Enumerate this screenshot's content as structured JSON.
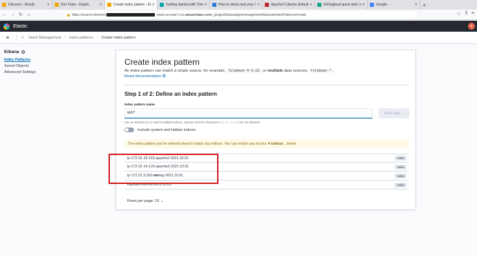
{
  "browser": {
    "tabs": [
      {
        "label": "Discover - Elastic",
        "color": "#f0a500",
        "active": false
      },
      {
        "label": "Dev Tools - Elastic",
        "color": "#f0a500",
        "active": false
      },
      {
        "label": "Create index pattern - Elastic",
        "color": "#f0a500",
        "active": true
      },
      {
        "label": "Getting started with Timelion",
        "color": "#00a4a6",
        "active": false
      },
      {
        "label": "How to stress test your CPU -",
        "color": "#2b7bd6",
        "active": false
      },
      {
        "label": "Apache2 Ubuntu Default Page: It",
        "color": "#c2272d",
        "active": false
      },
      {
        "label": "Winlogbeat quick start: install",
        "color": "#1aa48b",
        "active": false
      },
      {
        "label": "Google",
        "color": "#4285f4",
        "active": false
      }
    ],
    "url_prefix": "https://search-demoes",
    "url_host_mid": "-west-us-east-1.es.",
    "url_host": "amazonaws.com",
    "url_path": "/_plugin/kibana/app/management/kibana/indexPatterns/create"
  },
  "header": {
    "app_title": "Elastic",
    "avatar_initial": "a"
  },
  "breadcrumbs": [
    "Stack Management",
    "Index patterns",
    "Create index pattern"
  ],
  "sidenav": {
    "title": "Kibana",
    "items": [
      "Index Patterns",
      "Saved Objects",
      "Advanced Settings"
    ]
  },
  "panel": {
    "title": "Create index pattern",
    "desc_1": "An index pattern can match a single source, for example,",
    "code_1": "filebeat-4-3-22",
    "desc_2": ", or",
    "desc_bold": "multiple",
    "desc_3": "data sources,",
    "code_2": "filebeat-*",
    "desc_4": ".",
    "read_doc": "Read documentation",
    "step": "Step 1 of 2: Define an index pattern",
    "field_label": "Index pattern name",
    "field_value": "win*",
    "field_help": "Use an asterisk (*) to match multiple indices. Spaces and the characters \\, /, ?, \", <, >, | are not allowed.",
    "next_button": "Next step",
    "toggle_label": "Include system and hidden indices",
    "callout_1": "The index pattern you've entered doesn't match any indices. You can match any of your",
    "callout_bold": "4 indices",
    "callout_2": ", below.",
    "rows": [
      {
        "pre": "ip-172-31-10-110-apache2-2021.10.01",
        "hl": "",
        "post": "",
        "badge": "Index"
      },
      {
        "pre": "ip-172-31-14-120-apache2-2021.10.01",
        "hl": "",
        "post": "",
        "badge": "Index"
      },
      {
        "pre": "ip-172.31.3.182-",
        "hl": "win",
        "post": "log-2021.10.01",
        "badge": "Index"
      },
      {
        "pre": "logstashmetrics-2021.10.01",
        "hl": "",
        "post": "",
        "badge": "Index"
      }
    ],
    "rows_per_page": "Rows per page: 10"
  },
  "colors": {
    "accent": "#006bb4",
    "annotation": "#d0161b",
    "header_bg": "#25282f"
  }
}
